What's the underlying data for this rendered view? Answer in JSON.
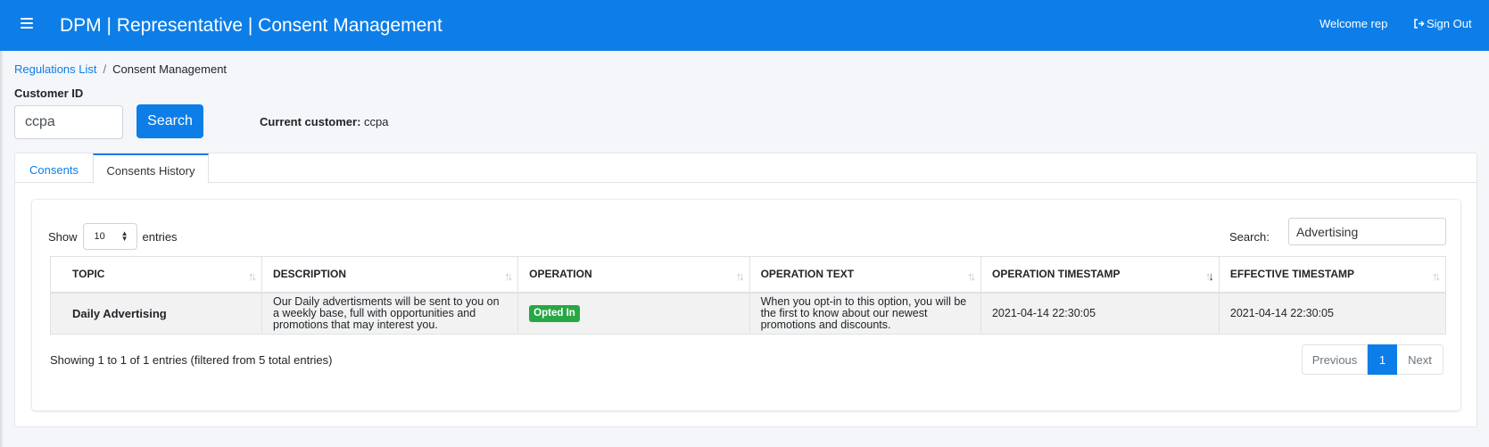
{
  "header": {
    "title": "DPM | Representative | Consent Management",
    "welcome": "Welcome rep",
    "signout": "Sign Out"
  },
  "breadcrumb": {
    "items": [
      "Regulations List",
      "Consent Management"
    ],
    "separator": "/"
  },
  "customer": {
    "label": "Customer ID",
    "input_value": "ccpa",
    "search_label": "Search",
    "current_label": "Current customer:",
    "current_value": "ccpa"
  },
  "tabs": [
    {
      "label": "Consents",
      "active": false
    },
    {
      "label": "Consents History",
      "active": true
    }
  ],
  "table_controls": {
    "show_label": "Show",
    "entries_label": "entries",
    "page_length": "10",
    "search_label": "Search:",
    "search_value": "Advertising"
  },
  "table": {
    "headers": [
      "TOPIC",
      "DESCRIPTION",
      "OPERATION",
      "OPERATION TEXT",
      "OPERATION TIMESTAMP",
      "EFFECTIVE TIMESTAMP"
    ],
    "rows": [
      {
        "topic": "Daily Advertising",
        "description": "Our Daily advertisments will be sent to you on a weekly base, full with opportunities and promotions that may interest you.",
        "operation": "Opted In",
        "operation_text": "When you opt-in to this option, you will be the first to know about our newest promotions and discounts.",
        "operation_timestamp": "2021-04-14 22:30:05",
        "effective_timestamp": "2021-04-14 22:30:05"
      }
    ]
  },
  "footer": {
    "info": "Showing 1 to 1 of 1 entries (filtered from 5 total entries)",
    "previous": "Previous",
    "current_page": "1",
    "next": "Next"
  },
  "colors": {
    "primary": "#0d7ee8",
    "success": "#28a745",
    "background": "#f4f6f9"
  }
}
